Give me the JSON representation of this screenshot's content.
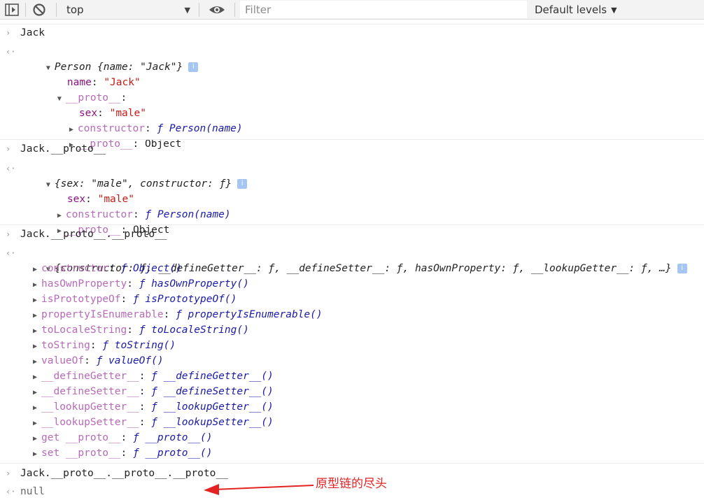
{
  "toolbar": {
    "context": "top",
    "filter_placeholder": "Filter",
    "levels": "Default levels"
  },
  "entries": {
    "e1": {
      "input": "Jack",
      "summary": "Person {name: \"Jack\"}",
      "name_key": "name",
      "name_val": "\"Jack\"",
      "proto_key": "__proto__",
      "sex_key": "sex",
      "sex_val": "\"male\"",
      "ctor_key": "constructor",
      "ctor_val": "ƒ Person(name)",
      "proto2_key": "__proto__",
      "proto2_val": "Object"
    },
    "e2": {
      "input": "Jack.__proto__",
      "summary": "{sex: \"male\", constructor: ƒ}",
      "sex_key": "sex",
      "sex_val": "\"male\"",
      "ctor_key": "constructor",
      "ctor_val": "ƒ Person(name)",
      "proto_key": "__proto__",
      "proto_val": "Object"
    },
    "e3": {
      "input": "Jack.__proto__.__proto__",
      "summary": "{constructor: ƒ, __defineGetter__: ƒ, __defineSetter__: ƒ, hasOwnProperty: ƒ, __lookupGetter__: ƒ, …}",
      "props": [
        {
          "key": "constructor",
          "val": "ƒ Object()"
        },
        {
          "key": "hasOwnProperty",
          "val": "ƒ hasOwnProperty()"
        },
        {
          "key": "isPrototypeOf",
          "val": "ƒ isPrototypeOf()"
        },
        {
          "key": "propertyIsEnumerable",
          "val": "ƒ propertyIsEnumerable()"
        },
        {
          "key": "toLocaleString",
          "val": "ƒ toLocaleString()"
        },
        {
          "key": "toString",
          "val": "ƒ toString()"
        },
        {
          "key": "valueOf",
          "val": "ƒ valueOf()"
        },
        {
          "key": "__defineGetter__",
          "val": "ƒ __defineGetter__()"
        },
        {
          "key": "__defineSetter__",
          "val": "ƒ __defineSetter__()"
        },
        {
          "key": "__lookupGetter__",
          "val": "ƒ __lookupGetter__()"
        },
        {
          "key": "__lookupSetter__",
          "val": "ƒ __lookupSetter__()"
        },
        {
          "key": "get __proto__",
          "val": "ƒ __proto__()"
        },
        {
          "key": "set __proto__",
          "val": "ƒ __proto__()"
        }
      ]
    },
    "e4": {
      "input": "Jack.__proto__.__proto__.__proto__",
      "result": "null"
    }
  },
  "annotation": {
    "text": "原型链的尽头",
    "color": "#e32323"
  },
  "icons": {
    "prompt": "›",
    "result": "‹·",
    "expanded": "▼",
    "collapsed": "▶",
    "info": "i"
  }
}
